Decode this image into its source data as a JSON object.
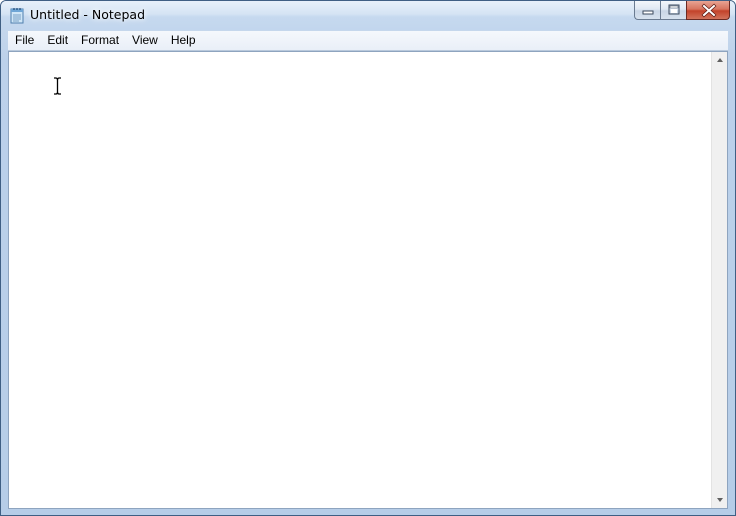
{
  "window": {
    "title": "Untitled - Notepad"
  },
  "icons": {
    "app": "notepad-app-icon",
    "minimize": "minimize-icon",
    "maximize": "maximize-icon",
    "close": "close-icon",
    "scroll_up": "scroll-up-arrow-icon",
    "scroll_down": "scroll-down-arrow-icon",
    "cursor": "text-cursor-icon"
  },
  "menubar": {
    "items": [
      {
        "label": "File"
      },
      {
        "label": "Edit"
      },
      {
        "label": "Format"
      },
      {
        "label": "View"
      },
      {
        "label": "Help"
      }
    ]
  },
  "editor": {
    "value": ""
  },
  "colors": {
    "title_gradient_top": "#e7f0fa",
    "close_button": "#c3432a",
    "frame_border": "#3f5f84"
  }
}
